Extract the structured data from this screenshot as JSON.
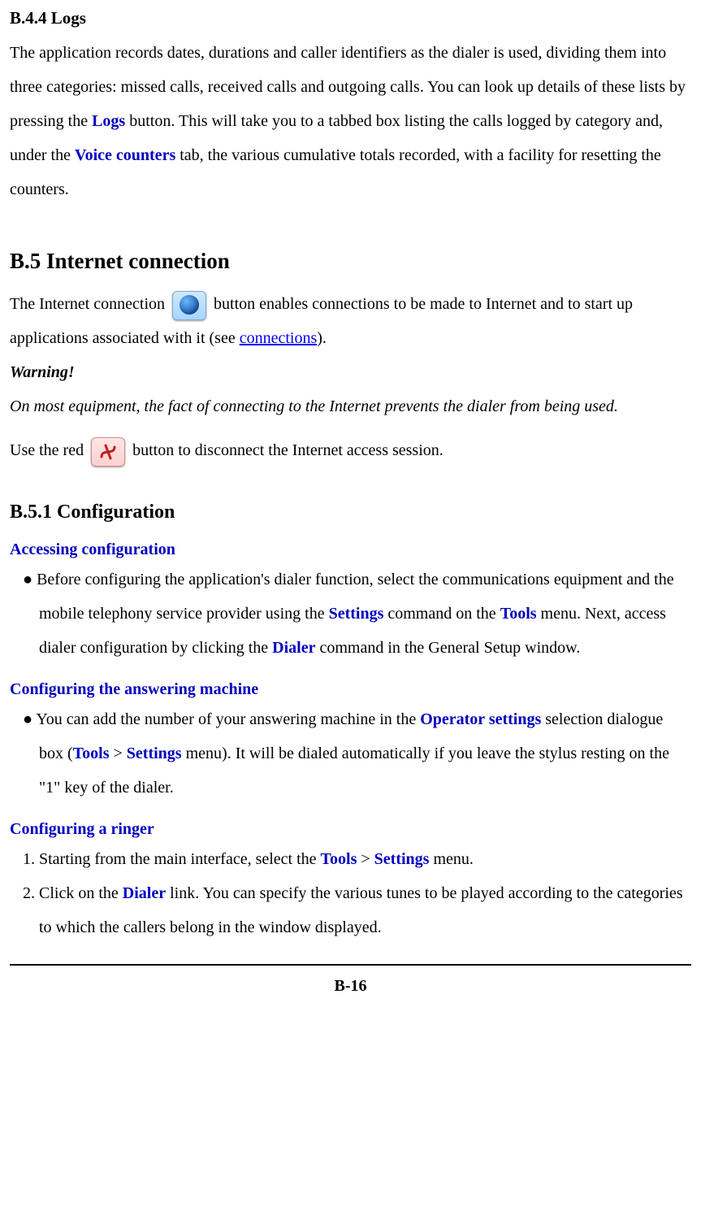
{
  "sections": {
    "logs": {
      "heading": "B.4.4 Logs",
      "p1a": "The application records dates, durations and caller identifiers as the dialer is used, dividing them into three categories: missed calls, received calls and outgoing calls. You can look up details of these lists by pressing the ",
      "logs_label": "Logs",
      "p1b": " button. This will take you to a tabbed box listing the calls logged by category and, under the ",
      "voice_counters_label": "Voice counters",
      "p1c": " tab, the various cumulative totals recorded, with a facility for resetting the counters."
    },
    "internet": {
      "heading": "B.5 Internet connection",
      "p1a": "The Internet connection ",
      "p1b": " button enables connections to be made to Internet and to start up applications associated with it (see ",
      "connections_link": "connections",
      "p1c": ").",
      "warning_label": "Warning!",
      "warning_text": "On most equipment, the fact of connecting to the Internet prevents the dialer from being used.",
      "p2a": "Use the red ",
      "p2b": " button to disconnect the Internet access session."
    },
    "config": {
      "heading": "B.5.1 Configuration",
      "accessing_heading": "Accessing configuration",
      "accessing_bullet_a": "Before configuring the application's dialer function, select the communications equipment and the mobile telephony service provider using the ",
      "settings_label": "Settings",
      "accessing_bullet_b": " command on the ",
      "tools_label": "Tools",
      "accessing_bullet_c": " menu. Next, access dialer configuration by clicking the ",
      "dialer_label": "Dialer",
      "accessing_bullet_d": " command in the General Setup window.",
      "answering_heading": "Configuring the answering machine",
      "answering_bullet_a": "You can add the number of your answering machine in the ",
      "operator_settings_label": "Operator settings",
      "answering_bullet_b": " selection dialogue box (",
      "answering_bullet_c": " > ",
      "answering_bullet_d": " menu). It will be dialed automatically if you leave the stylus resting on the \"1\" key of the dialer.",
      "ringer_heading": "Configuring a ringer",
      "ringer_1a": "1. Starting from the main interface, select the ",
      "ringer_1b": " > ",
      "ringer_1c": " menu.",
      "ringer_2a": "2. Click on the ",
      "ringer_2b": " link. You can specify the various tunes to be played according to the categories to which the callers belong in the window displayed."
    }
  },
  "footer": "B-16"
}
